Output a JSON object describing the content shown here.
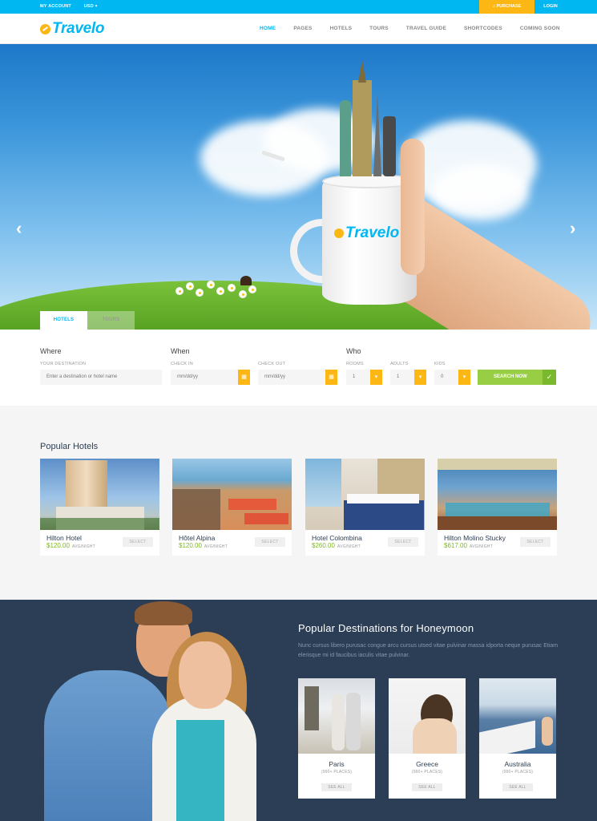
{
  "topbar": {
    "my_account": "MY ACCOUNT",
    "currency": "USD ▾",
    "purchase": "⌂ PURCHASE",
    "login": "LOGIN"
  },
  "header": {
    "logo": "Travelo",
    "nav": [
      "HOME",
      "PAGES",
      "HOTELS",
      "TOURS",
      "TRAVEL GUIDE",
      "SHORTCODES",
      "COMING SOON"
    ],
    "active_nav": "HOME"
  },
  "hero": {
    "mug_logo": "Travelo",
    "prev_arrow": "‹",
    "next_arrow": "›"
  },
  "search": {
    "tabs": [
      "HOTELS",
      "TOURS"
    ],
    "where_heading": "Where",
    "when_heading": "When",
    "who_heading": "Who",
    "destination_label": "YOUR DESTINATION",
    "destination_placeholder": "Enter a destination or hotel name",
    "checkin_label": "CHECK IN",
    "checkout_label": "CHECK OUT",
    "date_placeholder": "mm/dd/yy",
    "rooms_label": "ROOMS",
    "adults_label": "ADULTS",
    "kids_label": "KIDS",
    "rooms_value": "1",
    "adults_value": "1",
    "kids_value": "0",
    "search_button": "SEARCH NOW",
    "check_icon": "✓"
  },
  "popular_hotels": {
    "title": "Popular Hotels",
    "avg_label": "AVG/NIGHT",
    "select_label": "SELECT",
    "items": [
      {
        "name": "Hilton Hotel",
        "price": "$120.00"
      },
      {
        "name": "Hôtel Alpina",
        "price": "$120.00"
      },
      {
        "name": "Hotel Colombina",
        "price": "$260.00"
      },
      {
        "name": "Hilton Molino Stucky",
        "price": "$617.00"
      }
    ]
  },
  "honeymoon": {
    "title": "Popular Destinations for Honeymoon",
    "description": "Nunc cursus libero purusac congue arcu cursus utsed vitae pulvinar massa idporta neque purusac Etiam elerisque mi id faucibus iaculis vitae pulvinar.",
    "see_all": "SEE ALL",
    "items": [
      {
        "name": "Paris",
        "places": "(990+ PLACES)"
      },
      {
        "name": "Greece",
        "places": "(990+ PLACES)"
      },
      {
        "name": "Australia",
        "places": "(990+ PLACES)"
      }
    ]
  },
  "colors": {
    "brand_blue": "#01b7f2",
    "accent_yellow": "#fdb714",
    "green": "#98ce44",
    "navy": "#2c3e55"
  }
}
